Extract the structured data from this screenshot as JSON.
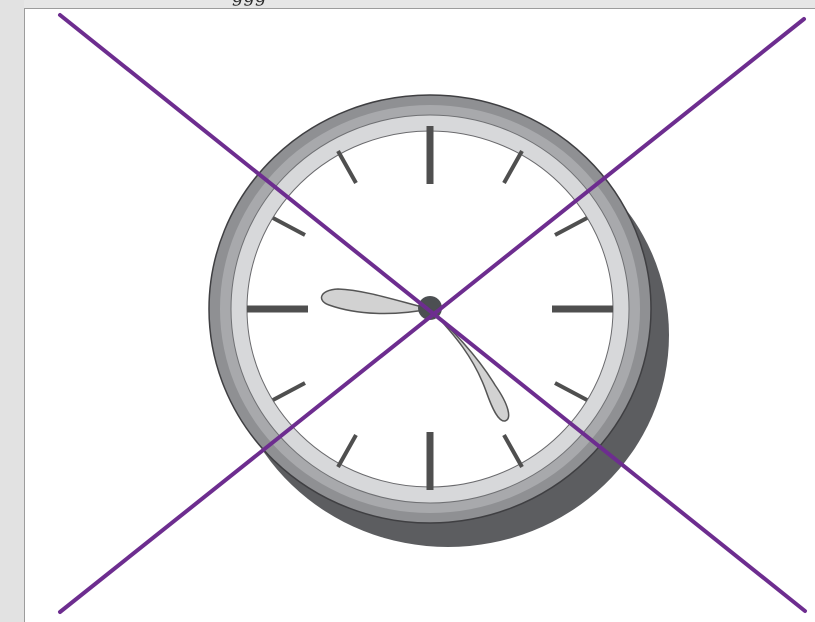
{
  "panel": {
    "top_text_fragment": "ggg"
  },
  "illustration": {
    "subject": "clock",
    "icon": "clock-icon",
    "overlay_icon": "x-mark-icon",
    "colors": {
      "canvas": "#ffffff",
      "frame_dark": "#6f7073",
      "frame_mid": "#9b9c9f",
      "frame_light": "#d6d7d9",
      "frame_shadow": "#5c5d60",
      "face": "#ffffff",
      "tick": "#4f4f4f",
      "hand_fill": "#d2d2d2",
      "hand_stroke": "#555555",
      "pivot": "#4c4f52",
      "cross": "#6d2d8f"
    }
  }
}
